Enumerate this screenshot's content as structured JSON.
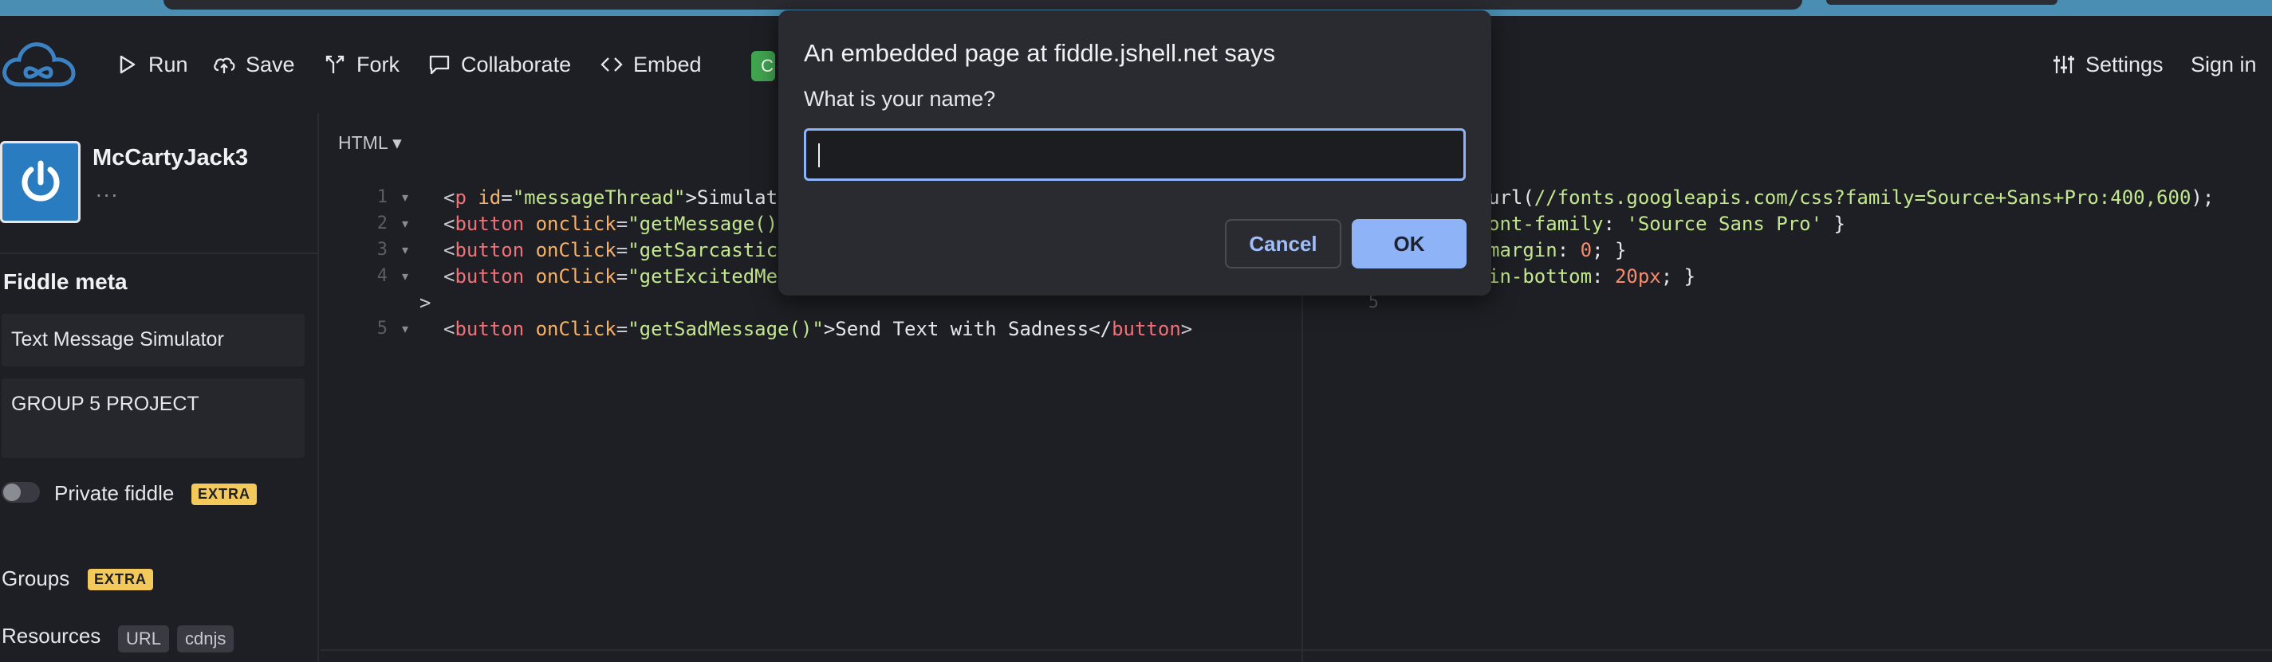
{
  "toolbar": {
    "run": "Run",
    "save": "Save",
    "fork": "Fork",
    "collaborate": "Collaborate",
    "embed": "Embed",
    "green_badge": "C",
    "settings": "Settings",
    "signin": "Sign in"
  },
  "sidebar": {
    "username": "McCartyJack3",
    "user_more": "...",
    "section_title": "Fiddle meta",
    "title_value": "Text Message Simulator",
    "description_value": "GROUP 5 PROJECT",
    "private_label": "Private fiddle",
    "extra": "EXTRA",
    "groups_label": "Groups",
    "resources_label": "Resources",
    "url_tag": "URL",
    "cdnjs_tag": "cdnjs"
  },
  "html_editor": {
    "language": "HTML ▾",
    "lines": [
      {
        "n": "1",
        "parts": [
          [
            "<",
            "punc"
          ],
          [
            "p",
            "tag"
          ],
          [
            " id",
            "attr"
          ],
          [
            "=",
            "punc"
          ],
          [
            "\"messageThread\"",
            "str"
          ],
          [
            ">Simulat",
            "text"
          ]
        ]
      },
      {
        "n": "2",
        "parts": [
          [
            "<",
            "punc"
          ],
          [
            "button",
            "tag"
          ],
          [
            " onclick",
            "attr"
          ],
          [
            "=",
            "punc"
          ],
          [
            "\"getMessage()",
            "str"
          ]
        ]
      },
      {
        "n": "3",
        "parts": [
          [
            "<",
            "punc"
          ],
          [
            "button",
            "tag"
          ],
          [
            " onClick",
            "attr"
          ],
          [
            "=",
            "punc"
          ],
          [
            "\"getSarcastic",
            "str"
          ]
        ]
      },
      {
        "n": "4",
        "parts": [
          [
            "<",
            "punc"
          ],
          [
            "button",
            "tag"
          ],
          [
            " onClick",
            "attr"
          ],
          [
            "=",
            "punc"
          ],
          [
            "\"getExcitedMe",
            "str"
          ]
        ]
      },
      {
        "n": "",
        "parts": [
          [
            ">",
            "punc"
          ]
        ]
      },
      {
        "n": "5",
        "parts": [
          [
            "<",
            "punc"
          ],
          [
            "button",
            "tag"
          ],
          [
            " onClick",
            "attr"
          ],
          [
            "=",
            "punc"
          ],
          [
            "\"getSadMessage()\"",
            "str"
          ],
          [
            ">Send Text with Sadness</",
            "text"
          ],
          [
            "button",
            "tag"
          ],
          [
            ">",
            "punc"
          ]
        ]
      }
    ]
  },
  "css_editor": {
    "lines": [
      {
        "n": "",
        "parts": [
          [
            "url(",
            "text"
          ],
          [
            "//fonts.googleapis.com/css?family=Source+Sans+Pro:400,600",
            "str"
          ],
          [
            ");",
            "text"
          ]
        ]
      },
      {
        "n": "",
        "parts": [
          [
            "ont-family",
            "prop"
          ],
          [
            ": ",
            "text"
          ],
          [
            "'Source Sans Pro'",
            "str"
          ],
          [
            " }",
            "text"
          ]
        ]
      },
      {
        "n": "",
        "parts": [
          [
            "margin",
            "prop"
          ],
          [
            ": ",
            "text"
          ],
          [
            "0",
            "num"
          ],
          [
            "; }",
            "text"
          ]
        ]
      },
      {
        "n": "",
        "parts": [
          [
            "in-bottom",
            "prop"
          ],
          [
            ": ",
            "text"
          ],
          [
            "20px",
            "num"
          ],
          [
            "; }",
            "text"
          ]
        ]
      },
      {
        "n": "5",
        "parts": []
      }
    ]
  },
  "dialog": {
    "title": "An embedded page at fiddle.jshell.net says",
    "message": "What is your name?",
    "input_value": "",
    "cancel": "Cancel",
    "ok": "OK"
  },
  "colors": {
    "background": "#1e1f24",
    "accent": "#8fb3f7",
    "extra_badge": "#f3c95b",
    "avatar": "#2a7cc0"
  }
}
